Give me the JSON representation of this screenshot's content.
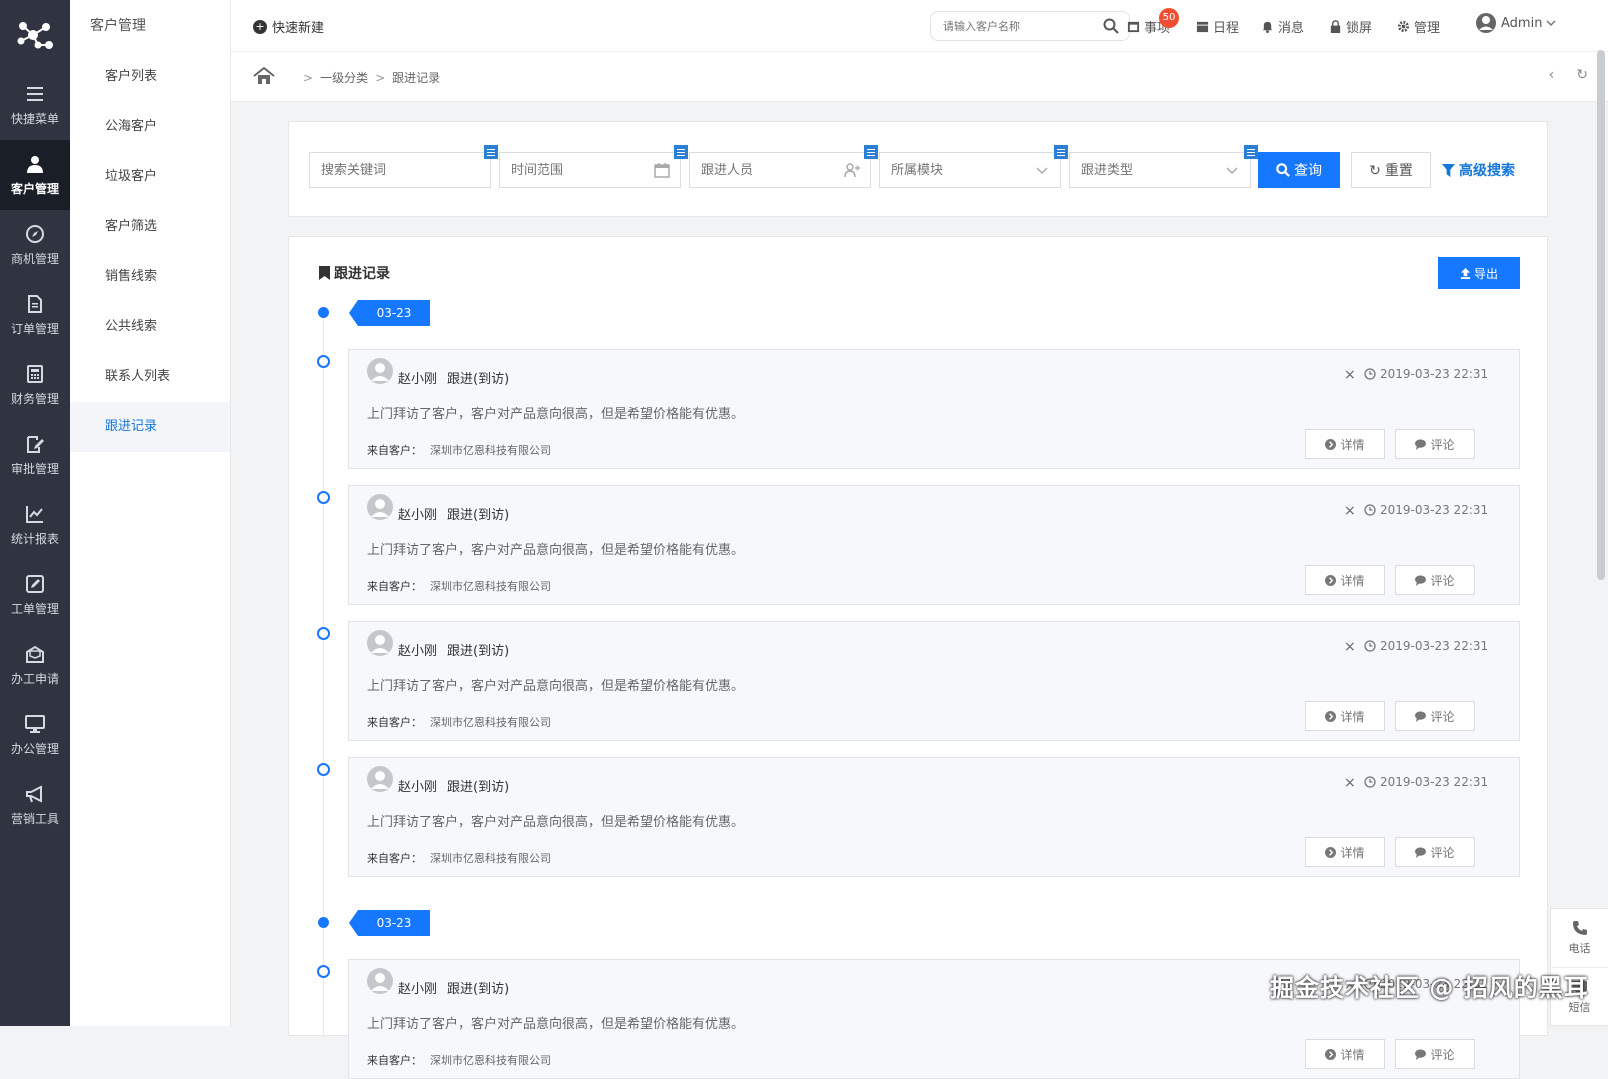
{
  "rail": [
    {
      "label": "快捷菜单",
      "icon": "menu-icon",
      "active": false
    },
    {
      "label": "客户管理",
      "icon": "user-icon",
      "active": true
    },
    {
      "label": "商机管理",
      "icon": "compass-icon",
      "active": false
    },
    {
      "label": "订单管理",
      "icon": "document-icon",
      "active": false
    },
    {
      "label": "财务管理",
      "icon": "calculator-icon",
      "active": false
    },
    {
      "label": "审批管理",
      "icon": "edit-icon",
      "active": false
    },
    {
      "label": "统计报表",
      "icon": "chart-icon",
      "active": false
    },
    {
      "label": "工单管理",
      "icon": "pencil-square-icon",
      "active": false
    },
    {
      "label": "办工申请",
      "icon": "envelope-icon",
      "active": false
    },
    {
      "label": "办公管理",
      "icon": "monitor-icon",
      "active": false
    },
    {
      "label": "营销工具",
      "icon": "megaphone-icon",
      "active": false
    }
  ],
  "subnav": {
    "title": "客户管理",
    "items": [
      {
        "label": "客户列表"
      },
      {
        "label": "公海客户"
      },
      {
        "label": "垃圾客户"
      },
      {
        "label": "客户筛选"
      },
      {
        "label": "销售线索"
      },
      {
        "label": "公共线索"
      },
      {
        "label": "联系人列表"
      },
      {
        "label": "跟进记录"
      }
    ]
  },
  "topbar": {
    "quick_new": "快速新建",
    "search_placeholder": "请输入客户名称",
    "todo": "事项",
    "todo_badge": "50",
    "schedule": "日程",
    "messages": "消息",
    "lock": "锁屏",
    "manage": "管理",
    "user": "Admin"
  },
  "breadcrumb": {
    "level1": "一级分类",
    "level2": "跟进记录"
  },
  "filters": {
    "keyword_placeholder": "搜索关键词",
    "time_placeholder": "时间范围",
    "person_placeholder": "跟进人员",
    "module_placeholder": "所属模块",
    "type_placeholder": "跟进类型",
    "query": "查询",
    "reset": "重置",
    "advanced": "高级搜索"
  },
  "records": {
    "title": "跟进记录",
    "export": "导出",
    "date_tag_1": "03-23",
    "date_tag_2": "03-23",
    "entries": [
      {
        "name": "赵小刚",
        "action": "跟进(到访)",
        "time": "2019-03-23 22:31",
        "desc": "上门拜访了客户，客户对产品意向很高，但是希望价格能有优惠。",
        "src_label": "来自客户：",
        "src": "深圳市亿恩科技有限公司",
        "detail": "详情",
        "comment": "评论",
        "close": "×"
      },
      {
        "name": "赵小刚",
        "action": "跟进(到访)",
        "time": "2019-03-23 22:31",
        "desc": "上门拜访了客户，客户对产品意向很高，但是希望价格能有优惠。",
        "src_label": "来自客户：",
        "src": "深圳市亿恩科技有限公司",
        "detail": "详情",
        "comment": "评论",
        "close": "×"
      },
      {
        "name": "赵小刚",
        "action": "跟进(到访)",
        "time": "2019-03-23 22:31",
        "desc": "上门拜访了客户，客户对产品意向很高，但是希望价格能有优惠。",
        "src_label": "来自客户：",
        "src": "深圳市亿恩科技有限公司",
        "detail": "详情",
        "comment": "评论",
        "close": "×"
      },
      {
        "name": "赵小刚",
        "action": "跟进(到访)",
        "time": "2019-03-23 22:31",
        "desc": "上门拜访了客户，客户对产品意向很高，但是希望价格能有优惠。",
        "src_label": "来自客户：",
        "src": "深圳市亿恩科技有限公司",
        "detail": "详情",
        "comment": "评论",
        "close": "×"
      },
      {
        "name": "赵小刚",
        "action": "跟进(到访)",
        "time": "2019-03-23 22:31",
        "desc": "上门拜访了客户，客户对产品意向很高，但是希望价格能有优惠。",
        "src_label": "来自客户：",
        "src": "深圳市亿恩科技有限公司",
        "detail": "详情",
        "comment": "评论",
        "close": "×"
      }
    ]
  },
  "float": {
    "phone": "电话",
    "sms": "短信"
  },
  "watermark": "掘金技术社区 @ 招风的黑耳",
  "colors": {
    "primary": "#1677ff",
    "rail": "#2f3440",
    "rail_active": "#1a1e27"
  }
}
